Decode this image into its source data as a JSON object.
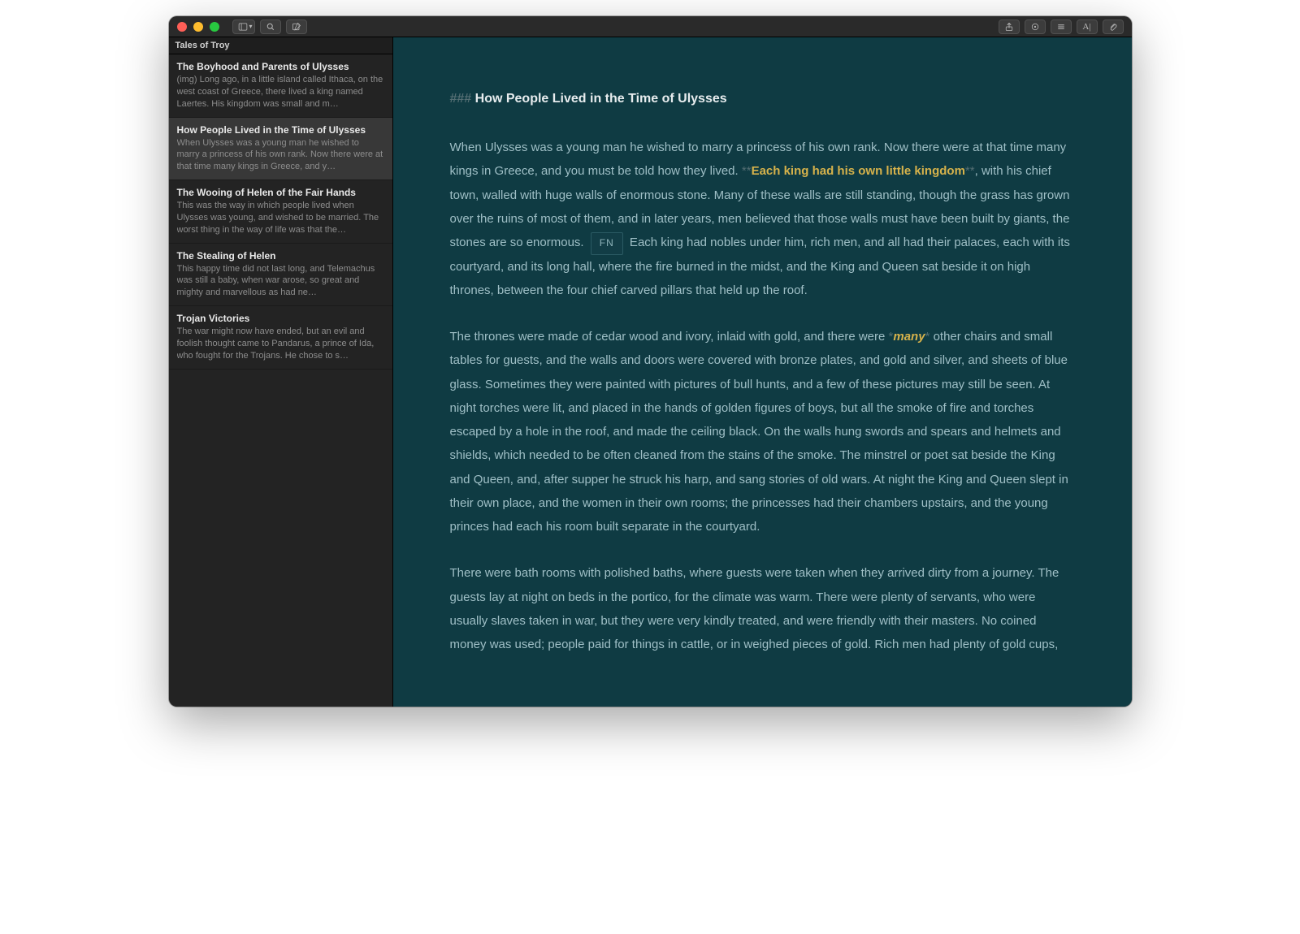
{
  "window": {
    "traffic": [
      "close",
      "minimize",
      "zoom"
    ]
  },
  "toolbar": {
    "left_icons": [
      "sidebar-toggle-icon",
      "sidebar-dropdown-icon",
      "search-icon",
      "compose-icon"
    ],
    "right_icons": [
      "share-icon",
      "preview-icon",
      "list-icon",
      "text-style-icon",
      "attachment-icon"
    ]
  },
  "sidebar": {
    "group_title": "Tales of Troy",
    "items": [
      {
        "title": "The Boyhood and Parents of Ulysses",
        "preview": "(img) Long ago, in a little island called Ithaca, on the west coast of Greece, there lived a king named Laertes. His kingdom was small and m…",
        "selected": false
      },
      {
        "title": "How People Lived in the Time of Ulysses",
        "preview": "When Ulysses was a young man he wished to marry a princess of his own rank. Now there were at that time many kings in Greece, and y…",
        "selected": true
      },
      {
        "title": "The Wooing of Helen of the Fair Hands",
        "preview": "This was the way in which people lived when Ulysses was young, and wished to be married. The worst thing in the way of life was that the…",
        "selected": false
      },
      {
        "title": "The Stealing of Helen",
        "preview": "This happy time did not last long, and Telemachus was still a baby, when war arose, so great and mighty and marvellous as had ne…",
        "selected": false
      },
      {
        "title": "Trojan Victories",
        "preview": "The war might now have ended, but an evil and foolish thought came to Pandarus, a prince of Ida, who fought for the Trojans. He chose to s…",
        "selected": false
      }
    ]
  },
  "document": {
    "heading_prefix": "### ",
    "heading": "How People Lived in the Time of Ulysses",
    "para1_a": "When Ulysses was a young man he wished to marry a princess of his own rank. Now there were at that time many kings in Greece, and you must be told how they lived. ",
    "strong_open": "**",
    "strong_text": "Each king had his own little kingdom",
    "strong_close": "**",
    "para1_b": ", with his chief town, walled with huge walls of enormous stone. Many of these walls are still standing, though the grass has grown over the ruins of most of them, and in later years, men believed that those walls must have been built by giants, the stones are so enormous. ",
    "fn_label": "FN",
    "para1_c": " Each king had nobles under him, rich men, and all had their palaces, each with its courtyard, and its long hall, where the fire burned in the midst, and the King and Queen sat beside it on high thrones, between the four chief carved pillars that held up the roof.",
    "para2_a": "The thrones were made of cedar wood and ivory, inlaid with gold, and there were ",
    "em_open": "*",
    "em_text": "many",
    "em_close": "*",
    "para2_b": " other chairs and small tables for guests, and the walls and doors were covered with bronze plates, and gold and silver, and sheets of blue glass. Sometimes they were painted with pictures of bull hunts, and a few of these pictures may still be seen. At night torches were lit, and placed in the hands of golden figures of boys, but all the smoke of fire and torches escaped by a hole in the roof, and made the ceiling black. On the walls hung swords and spears and helmets and shields, which needed to be often cleaned from the stains of the smoke. The minstrel or poet sat beside the King and Queen, and, after supper he struck his harp, and sang stories of old wars. At night the King and Queen slept in their own place, and the women in their own rooms; the princesses had their chambers upstairs, and the young princes had each his room built separate in the courtyard.",
    "para3": "There were bath rooms with polished baths, where guests were taken when they arrived dirty from a journey. The guests lay at night on beds in the portico, for the climate was warm. There were plenty of servants, who were usually slaves taken in war, but they were very kindly treated, and were friendly with their masters. No coined money was used; people paid for things in cattle, or in weighed pieces of gold. Rich men had plenty of gold cups,"
  }
}
